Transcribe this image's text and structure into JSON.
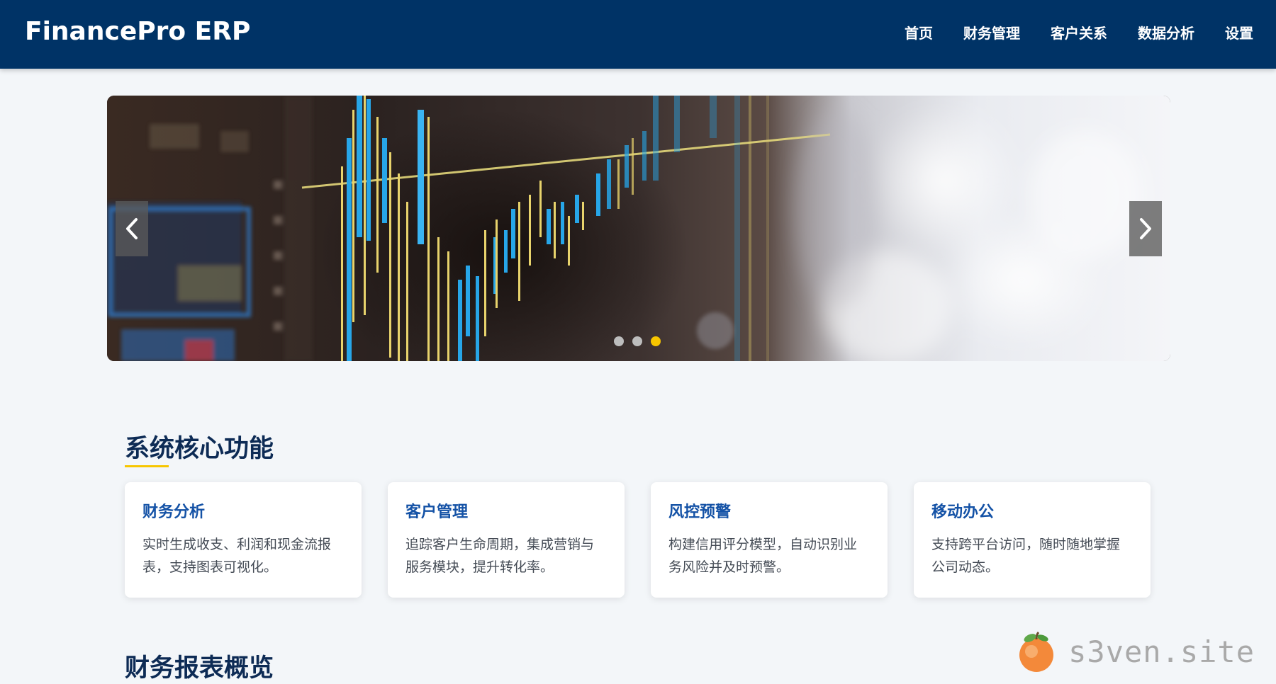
{
  "header": {
    "brand": "FinancePro ERP",
    "nav": [
      {
        "label": "首页"
      },
      {
        "label": "财务管理"
      },
      {
        "label": "客户关系"
      },
      {
        "label": "数据分析"
      },
      {
        "label": "设置"
      }
    ]
  },
  "carousel": {
    "prev_icon": "chevron-left-icon",
    "next_icon": "chevron-right-icon",
    "slide_count": 3,
    "active_slide": 3
  },
  "features": {
    "title": "系统核心功能",
    "cards": [
      {
        "title": "财务分析",
        "desc": "实时生成收支、利润和现金流报表，支持图表可视化。"
      },
      {
        "title": "客户管理",
        "desc": "追踪客户生命周期，集成营销与服务模块，提升转化率。"
      },
      {
        "title": "风控预警",
        "desc": "构建信用评分模型，自动识别业务风险并及时预警。"
      },
      {
        "title": "移动办公",
        "desc": "支持跨平台访问，随时随地掌握公司动态。"
      }
    ]
  },
  "reports": {
    "title": "财务报表概览"
  },
  "watermark": {
    "text": "s3ven.site",
    "icon": "peach-icon"
  },
  "colors": {
    "header_bg": "#003366",
    "accent": "#f7c600",
    "card_title": "#1452a6",
    "section_title": "#0d2b55",
    "page_bg": "#f3f6f9"
  }
}
